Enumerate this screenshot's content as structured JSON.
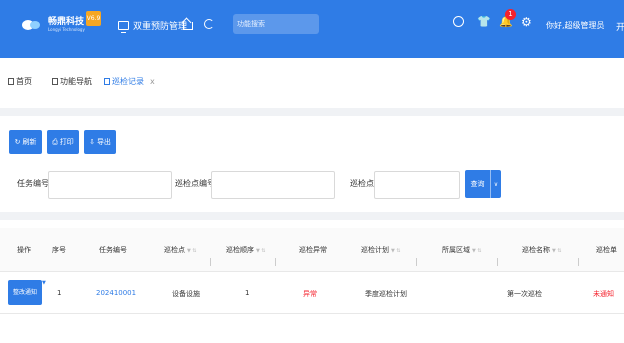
{
  "header": {
    "logo_name": "畅鼎科技",
    "logo_subtitle": "Longyi Technology",
    "version": "V6.9",
    "screen_title": "双重预防管理",
    "search_placeholder": "功能搜索",
    "notification_count": "1",
    "username": "你好,超级管理员",
    "overflow_text": "开",
    "colors": {
      "primary": "#2f7ce6",
      "badge": "#f5222d",
      "version": "#f5a623"
    }
  },
  "tabs": [
    {
      "label": "首页",
      "icon": "tab-doc-icon"
    },
    {
      "label": "功能导航",
      "icon": "tab-doc-icon"
    },
    {
      "label": "巡检记录",
      "icon": "tab-doc-icon",
      "active": true,
      "close": "x"
    }
  ],
  "toolbar": {
    "refresh": "刷新",
    "print": "打印",
    "export": "导出"
  },
  "filters": {
    "task_no_label": "任务编号",
    "point_no_label": "巡检点编号",
    "point_label": "巡检点",
    "query": "查询",
    "query_caret": "∨"
  },
  "table": {
    "columns": [
      "操作",
      "序号",
      "任务编号",
      "巡检点",
      "巡检顺序",
      "巡检异常",
      "巡检计划",
      "所属区域",
      "巡检名称",
      "巡检单"
    ],
    "sort_glyph": "▼ ⇅",
    "rows": [
      {
        "action": "整改通知",
        "index": "1",
        "task_no": "202410001",
        "point": "设备设施",
        "order": "1",
        "abnormal": "异常",
        "plan": "季度巡检计划",
        "area": "",
        "name": "第一次巡检",
        "sheet": "未通知"
      }
    ]
  }
}
